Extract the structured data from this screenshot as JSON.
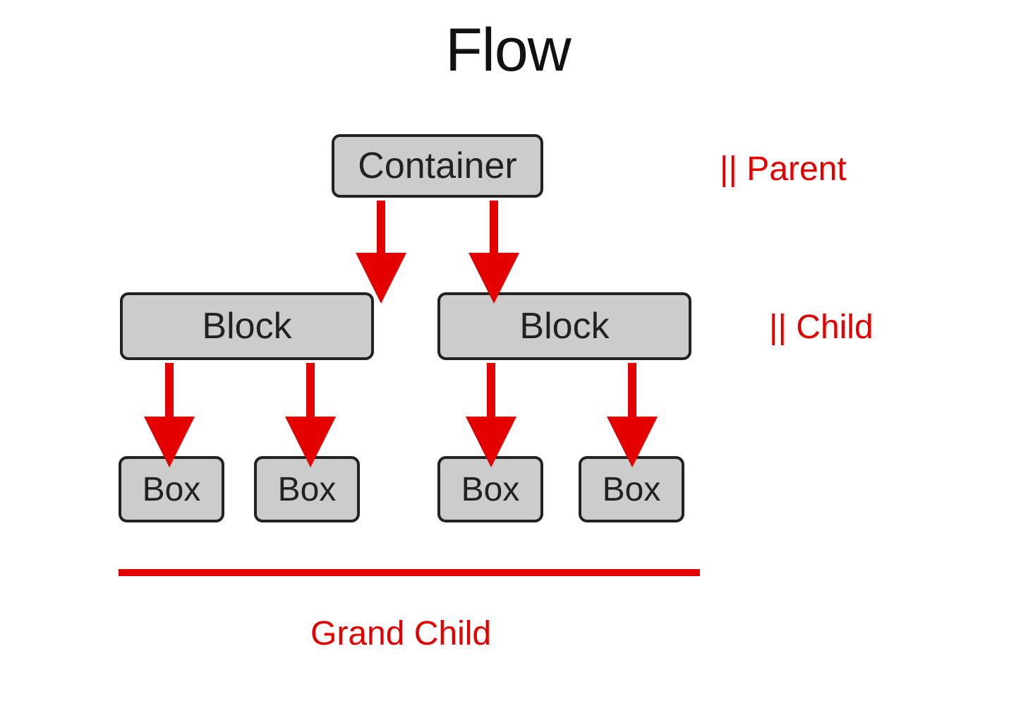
{
  "title": "Flow",
  "nodes": {
    "container": "Container",
    "block_left": "Block",
    "block_right": "Block",
    "box1": "Box",
    "box2": "Box",
    "box3": "Box",
    "box4": "Box"
  },
  "annotations": {
    "parent": "|| Parent",
    "child": "|| Child",
    "grandchild": "Grand Child"
  },
  "colors": {
    "node_bg": "#cccccc",
    "node_border": "#222222",
    "accent": "#e50000"
  }
}
